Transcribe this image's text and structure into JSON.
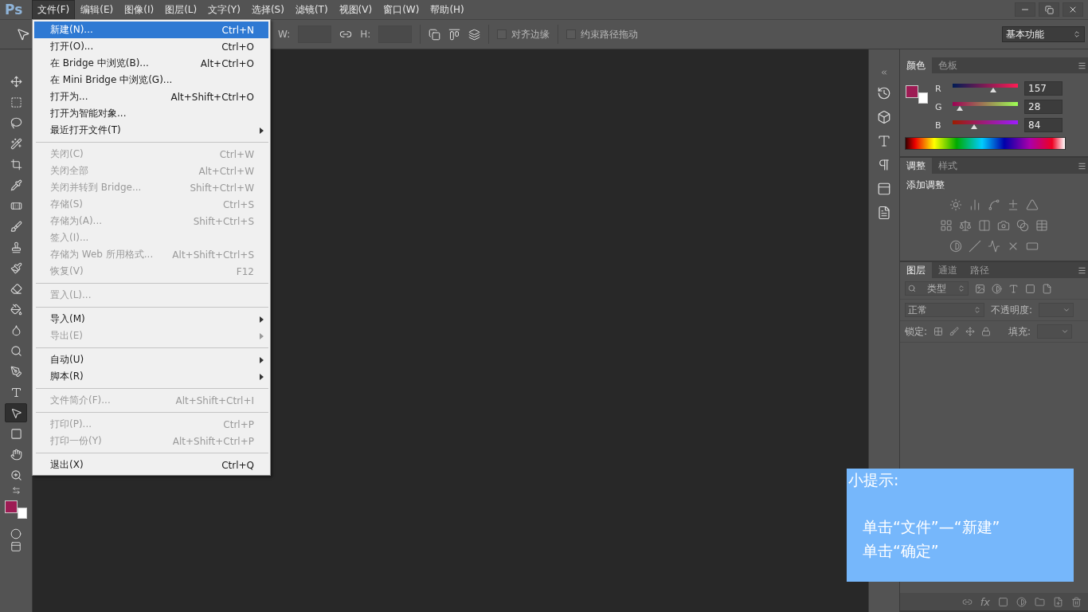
{
  "app_logo": "Ps",
  "menu_bar": [
    {
      "label": "文件(F)",
      "selected": true
    },
    {
      "label": "编辑(E)",
      "selected": false
    },
    {
      "label": "图像(I)",
      "selected": false
    },
    {
      "label": "图层(L)",
      "selected": false
    },
    {
      "label": "文字(Y)",
      "selected": false
    },
    {
      "label": "选择(S)",
      "selected": false
    },
    {
      "label": "滤镜(T)",
      "selected": false
    },
    {
      "label": "视图(V)",
      "selected": false
    },
    {
      "label": "窗口(W)",
      "selected": false
    },
    {
      "label": "帮助(H)",
      "selected": false
    }
  ],
  "options_bar": {
    "w_label": "W:",
    "h_label": "H:",
    "checkboxes": [
      {
        "label": "对齐边缘",
        "checked": false
      },
      {
        "label": "约束路径拖动",
        "checked": false
      }
    ],
    "workspace": "基本功能"
  },
  "file_menu": {
    "groups": [
      [
        {
          "label": "新建(N)...",
          "shortcut": "Ctrl+N",
          "disabled": false,
          "submenu": false,
          "selected": true
        },
        {
          "label": "打开(O)...",
          "shortcut": "Ctrl+O",
          "disabled": false,
          "submenu": false,
          "selected": false
        },
        {
          "label": "在 Bridge 中浏览(B)...",
          "shortcut": "Alt+Ctrl+O",
          "disabled": false,
          "submenu": false,
          "selected": false
        },
        {
          "label": "在 Mini Bridge 中浏览(G)...",
          "disabled": false,
          "submenu": false,
          "selected": false
        },
        {
          "label": "打开为...",
          "shortcut": "Alt+Shift+Ctrl+O",
          "disabled": false,
          "submenu": false,
          "selected": false
        },
        {
          "label": "打开为智能对象...",
          "disabled": false,
          "submenu": false,
          "selected": false
        },
        {
          "label": "最近打开文件(T)",
          "disabled": false,
          "submenu": true,
          "selected": false
        }
      ],
      [
        {
          "label": "关闭(C)",
          "shortcut": "Ctrl+W",
          "disabled": true,
          "submenu": false,
          "selected": false
        },
        {
          "label": "关闭全部",
          "shortcut": "Alt+Ctrl+W",
          "disabled": true,
          "submenu": false,
          "selected": false
        },
        {
          "label": "关闭并转到 Bridge...",
          "shortcut": "Shift+Ctrl+W",
          "disabled": true,
          "submenu": false,
          "selected": false
        },
        {
          "label": "存储(S)",
          "shortcut": "Ctrl+S",
          "disabled": true,
          "submenu": false,
          "selected": false
        },
        {
          "label": "存储为(A)...",
          "shortcut": "Shift+Ctrl+S",
          "disabled": true,
          "submenu": false,
          "selected": false
        },
        {
          "label": "签入(I)...",
          "disabled": true,
          "submenu": false,
          "selected": false
        },
        {
          "label": "存储为 Web 所用格式...",
          "shortcut": "Alt+Shift+Ctrl+S",
          "disabled": true,
          "submenu": false,
          "selected": false
        },
        {
          "label": "恢复(V)",
          "shortcut": "F12",
          "disabled": true,
          "submenu": false,
          "selected": false
        }
      ],
      [
        {
          "label": "置入(L)...",
          "disabled": true,
          "submenu": false,
          "selected": false
        }
      ],
      [
        {
          "label": "导入(M)",
          "disabled": false,
          "submenu": true,
          "selected": false
        },
        {
          "label": "导出(E)",
          "disabled": true,
          "submenu": true,
          "selected": false
        }
      ],
      [
        {
          "label": "自动(U)",
          "disabled": false,
          "submenu": true,
          "selected": false
        },
        {
          "label": "脚本(R)",
          "disabled": false,
          "submenu": true,
          "selected": false
        }
      ],
      [
        {
          "label": "文件简介(F)...",
          "shortcut": "Alt+Shift+Ctrl+I",
          "disabled": true,
          "submenu": false,
          "selected": false
        }
      ],
      [
        {
          "label": "打印(P)...",
          "shortcut": "Ctrl+P",
          "disabled": true,
          "submenu": false,
          "selected": false
        },
        {
          "label": "打印一份(Y)",
          "shortcut": "Alt+Shift+Ctrl+P",
          "disabled": true,
          "submenu": false,
          "selected": false
        }
      ],
      [
        {
          "label": "退出(X)",
          "shortcut": "Ctrl+Q",
          "disabled": false,
          "submenu": false,
          "selected": false
        }
      ]
    ]
  },
  "tools": [
    {
      "kind": "move",
      "selected": false
    },
    {
      "kind": "marquee",
      "selected": false
    },
    {
      "kind": "lasso",
      "selected": false
    },
    {
      "kind": "quick-select",
      "selected": false
    },
    {
      "kind": "crop",
      "selected": false
    },
    {
      "kind": "eyedropper",
      "selected": false
    },
    {
      "kind": "healing",
      "selected": false
    },
    {
      "kind": "brush",
      "selected": false
    },
    {
      "kind": "stamp",
      "selected": false
    },
    {
      "kind": "history-brush",
      "selected": false
    },
    {
      "kind": "eraser",
      "selected": false
    },
    {
      "kind": "bucket",
      "selected": false
    },
    {
      "kind": "blur",
      "selected": false
    },
    {
      "kind": "dodge",
      "selected": false
    },
    {
      "kind": "pen",
      "selected": false
    },
    {
      "kind": "type",
      "selected": false
    },
    {
      "kind": "path-select",
      "selected": true
    },
    {
      "kind": "rectangle",
      "selected": false
    },
    {
      "kind": "hand",
      "selected": false
    },
    {
      "kind": "zoom",
      "selected": false
    }
  ],
  "tool_colors": [
    {
      "kind": "foreground",
      "color": "#9d1c54"
    },
    {
      "kind": "background",
      "color": "#ffffff"
    }
  ],
  "color_panel": {
    "tabs": [
      {
        "label": "颜色",
        "selected": true
      },
      {
        "label": "色板",
        "selected": false
      }
    ],
    "swatches": [
      {
        "kind": "foreground",
        "color": "#9d1c54"
      },
      {
        "kind": "background",
        "color": "#ffffff"
      }
    ],
    "channels": [
      {
        "name": "R",
        "level": 0.62,
        "value": "157"
      },
      {
        "name": "G",
        "level": 0.11,
        "value": "28"
      },
      {
        "name": "B",
        "level": 0.33,
        "value": "84"
      }
    ]
  },
  "adjustments_panel": {
    "tabs": [
      {
        "label": "调整",
        "selected": true
      },
      {
        "label": "样式",
        "selected": false
      }
    ],
    "title": "添加调整"
  },
  "layers_panel": {
    "tabs": [
      {
        "label": "图层",
        "selected": true
      },
      {
        "label": "通道",
        "selected": false
      },
      {
        "label": "路径",
        "selected": false
      }
    ],
    "filter": "类型",
    "blend_mode": "正常",
    "opacity_label": "不透明度:",
    "lock_label": "锁定:",
    "fill_label": "填充:",
    "fx_label": "fx"
  },
  "tip": {
    "title": "小提示:",
    "lines": [
      "单击“文件”—“新建”",
      "单击“确定”"
    ]
  }
}
